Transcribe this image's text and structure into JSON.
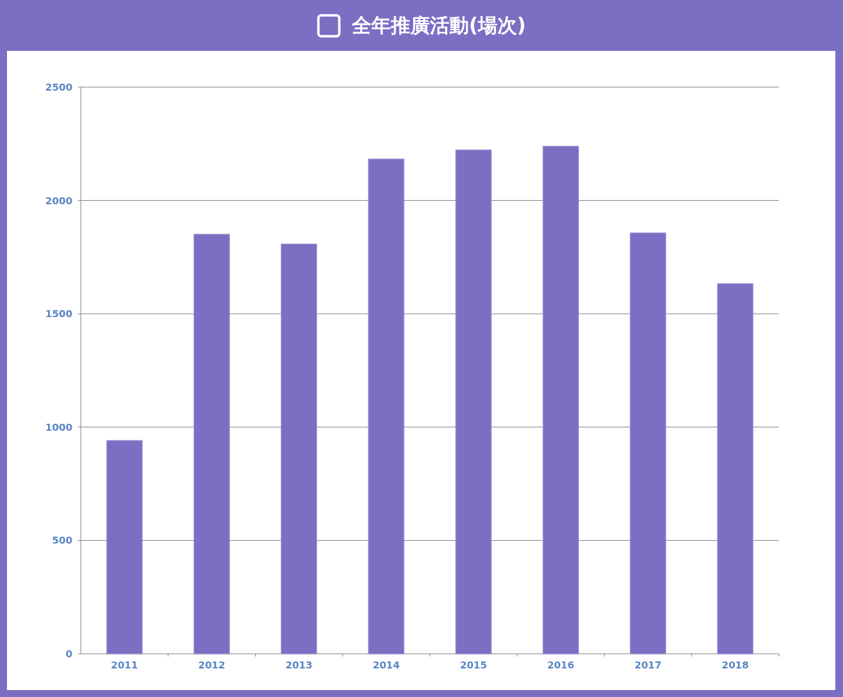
{
  "header": {
    "title": "全年推廣活動(場次)"
  },
  "chart": {
    "chart_data": {
      "type": "bar",
      "categories": [
        "2011",
        "2012",
        "2013",
        "2014",
        "2015",
        "2016",
        "2017",
        "2018"
      ],
      "series": [
        {
          "color": "#7b6fc4",
          "values": [
            941,
            1851,
            1808,
            2183,
            2223,
            2239,
            1857,
            1633
          ]
        }
      ],
      "grid": true,
      "ylim": [
        0,
        2500
      ],
      "yticks": [
        0,
        500,
        1000,
        1500,
        2000,
        2500
      ]
    }
  }
}
